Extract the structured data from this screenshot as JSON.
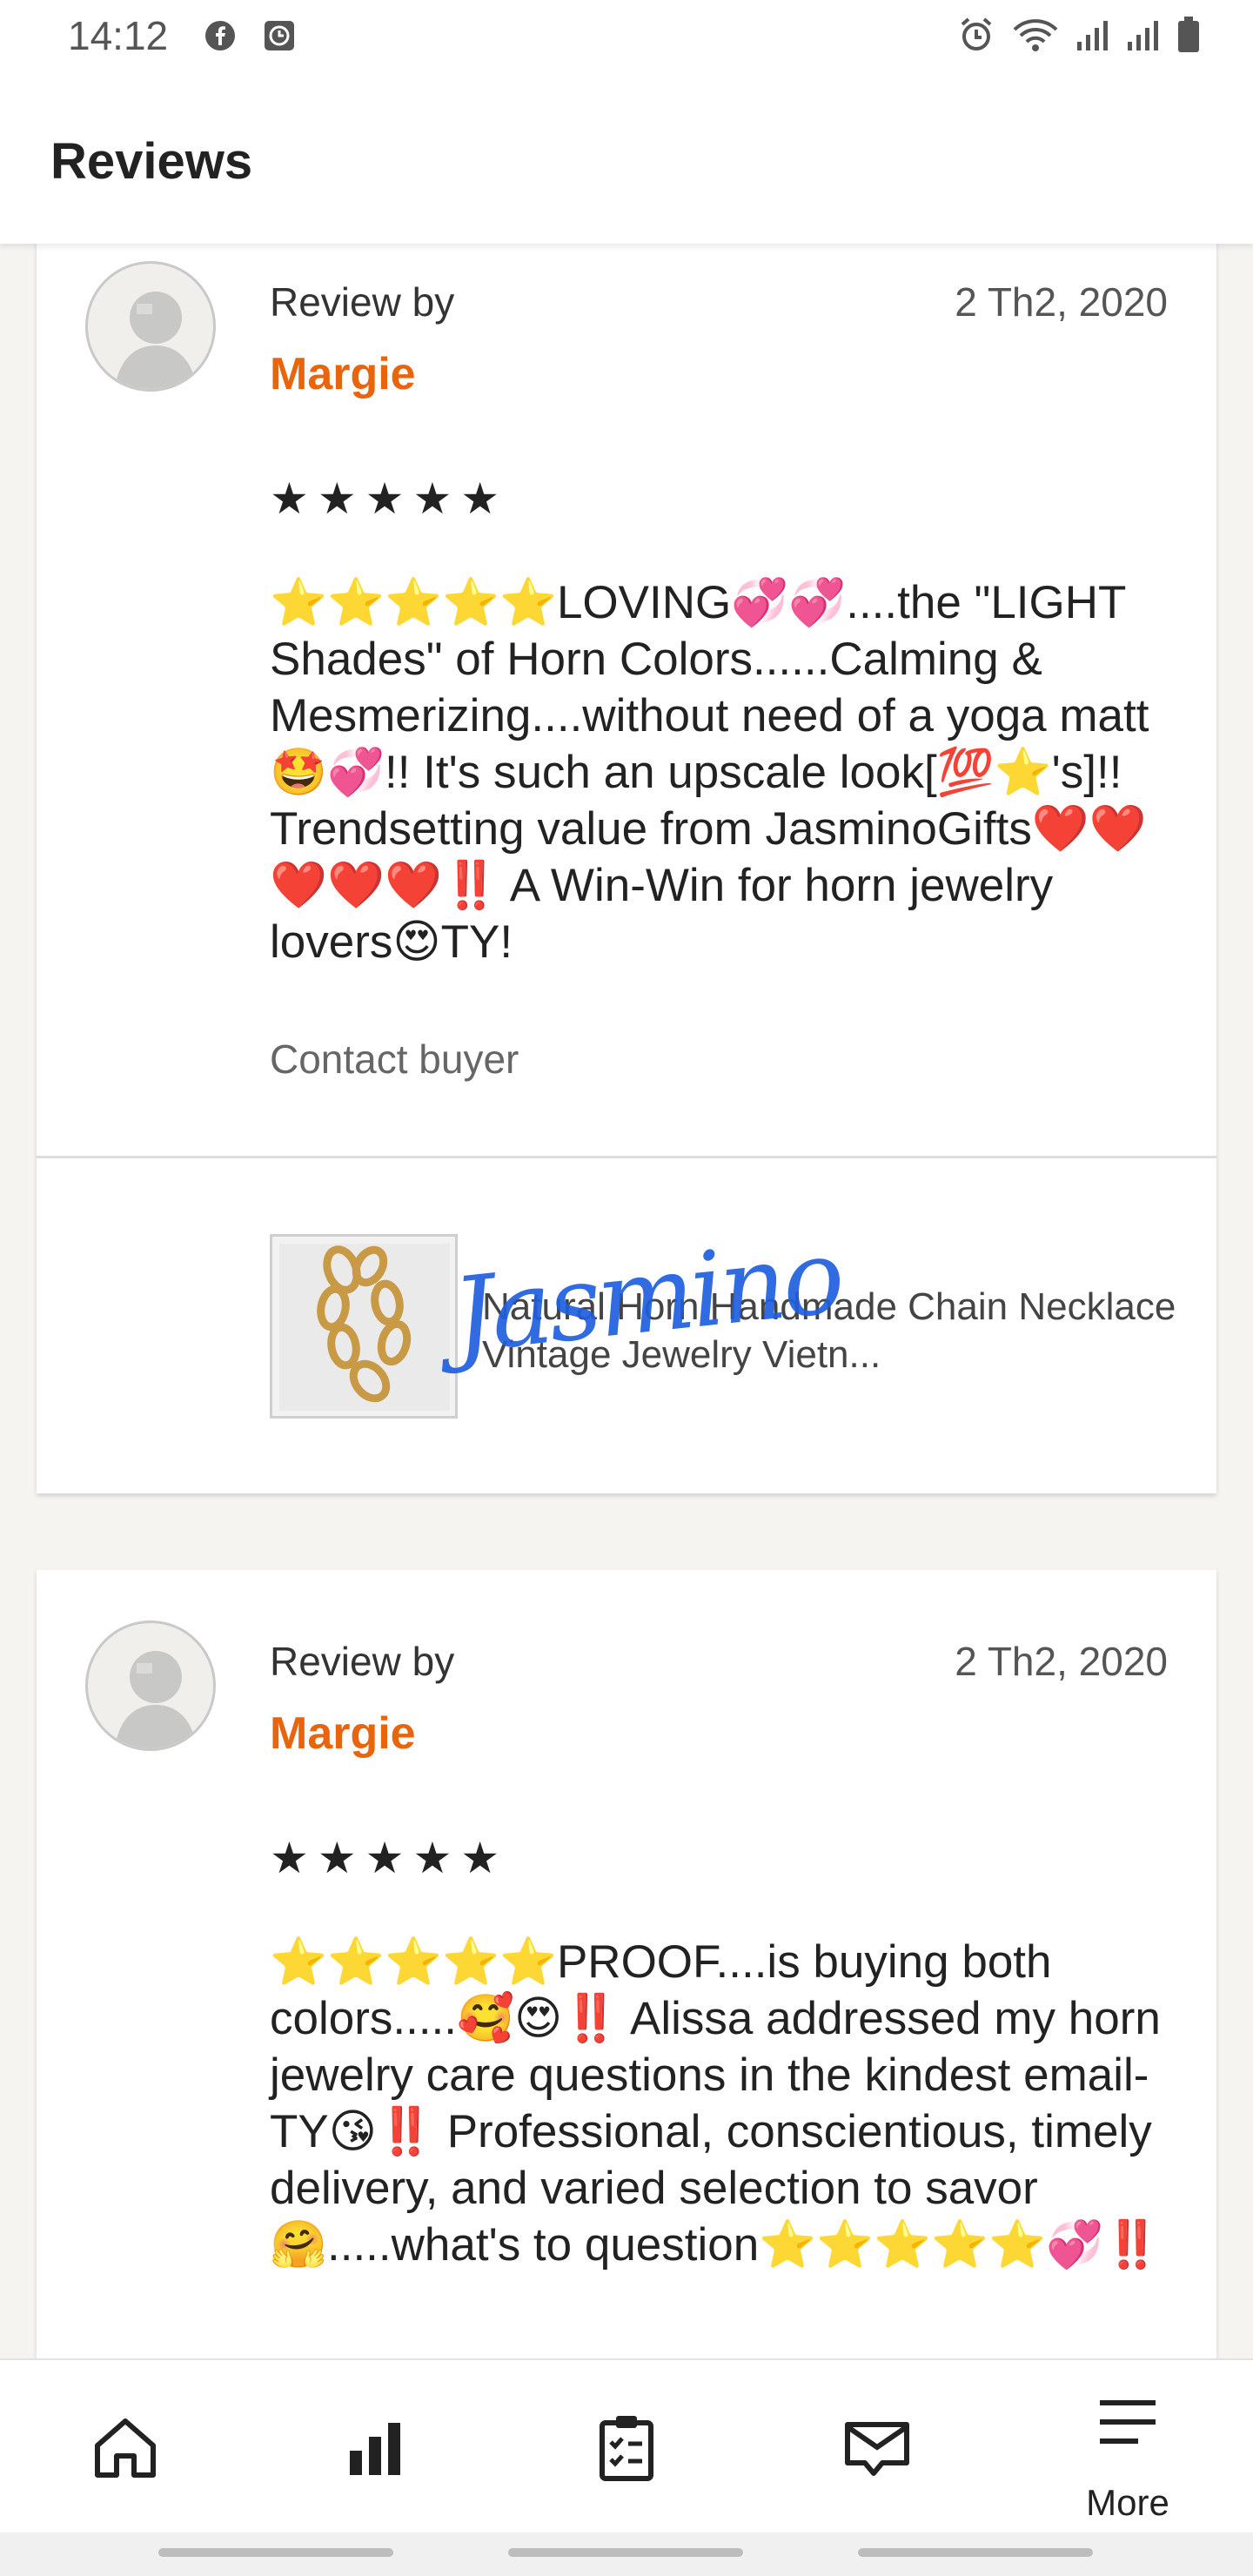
{
  "status_bar": {
    "time": "14:12",
    "left_icons": [
      "facebook-icon",
      "clock-app-icon"
    ],
    "right_icons": [
      "alarm-icon",
      "wifi-icon",
      "signal-icon",
      "signal-icon-2",
      "battery-icon"
    ]
  },
  "header": {
    "title": "Reviews"
  },
  "reviews": [
    {
      "review_by_label": "Review by",
      "reviewer": "Margie",
      "date": "2 Th2, 2020",
      "stars": "★★★★★",
      "rating": 5,
      "text": "⭐⭐⭐⭐⭐LOVING💞💞....the \"LIGHT Shades\" of Horn Colors......Calming & Mesmerizing....without need of a yoga matt🤩💞!! It's such an upscale look[💯⭐'s]!! Trendsetting value from JasminoGifts❤️❤️❤️❤️❤️‼️ A Win-Win for horn jewelry lovers😍TY!",
      "contact_label": "Contact buyer",
      "product": {
        "title": "Natural Horn Handmade Chain Necklace Vintage Jewelry Vietn...",
        "watermark": "Jasmino"
      }
    },
    {
      "review_by_label": "Review by",
      "reviewer": "Margie",
      "date": "2 Th2, 2020",
      "stars": "★★★★★",
      "rating": 5,
      "text": "⭐⭐⭐⭐⭐PROOF....is buying both colors.....🥰😍‼️ Alissa addressed my horn jewelry care questions in the kindest email-TY😘‼️ Professional, conscientious, timely delivery, and varied selection to savor🤗.....what's to question⭐⭐⭐⭐⭐💞‼️"
    }
  ],
  "bottom_nav": {
    "items": [
      {
        "icon": "home-icon",
        "label": ""
      },
      {
        "icon": "stats-icon",
        "label": ""
      },
      {
        "icon": "orders-icon",
        "label": ""
      },
      {
        "icon": "messages-icon",
        "label": ""
      },
      {
        "icon": "menu-icon",
        "label": "More"
      }
    ]
  },
  "colors": {
    "accent": "#e8650e",
    "background": "#f5f4f1",
    "card": "#ffffff"
  }
}
